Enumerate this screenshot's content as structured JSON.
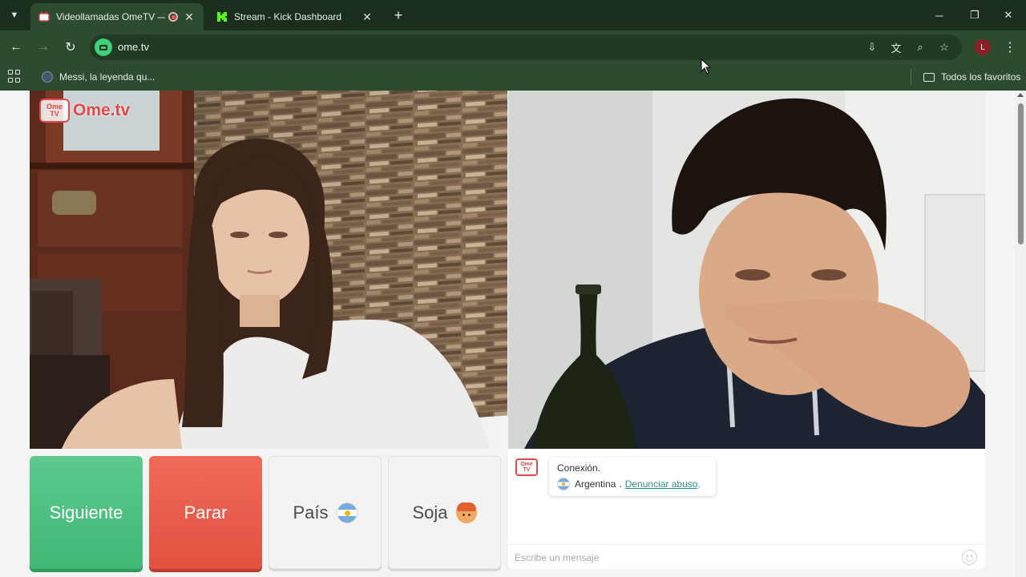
{
  "tabs": [
    {
      "title": "Videollamadas OmeTV — A",
      "active": true,
      "favicon": "ometv-favicon",
      "recording": true
    },
    {
      "title": "Stream - Kick Dashboard",
      "active": false,
      "favicon": "kick-favicon"
    }
  ],
  "toolbar": {
    "url": "ome.tv"
  },
  "profile_initial": "L",
  "bookmarks": {
    "items": [
      {
        "label": "Messi, la leyenda qu..."
      }
    ],
    "all_label": "Todos los favoritos"
  },
  "page": {
    "logo": {
      "small": "Ome\nTV",
      "text": "Ome.tv"
    },
    "buttons": {
      "next": "Siguiente",
      "stop": "Parar",
      "country": "País",
      "gender": "Soja"
    },
    "chat": {
      "status": "Conexión.",
      "country": "Argentina",
      "separator": ".",
      "report_link": "Denunciar abuso",
      "report_suffix": ".",
      "input_placeholder": "Escribe un mensaje"
    }
  },
  "colors": {
    "next": "#4cbf80",
    "stop": "#e85d4b",
    "brand": "#e4484a",
    "link": "#2f8f8c"
  }
}
